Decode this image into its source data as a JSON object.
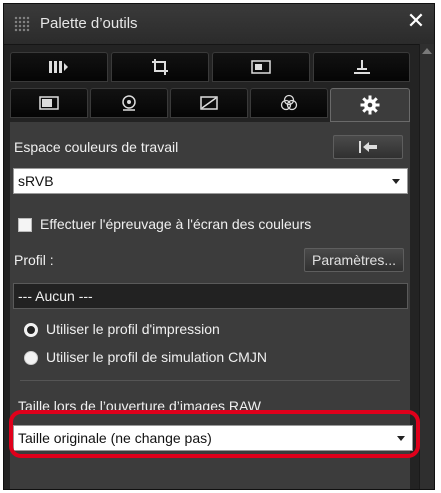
{
  "window": {
    "title": "Palette d’outils",
    "close_glyph": "✕"
  },
  "toolbar_row1": [
    {
      "icon": "page-bars-icon"
    },
    {
      "icon": "crop-icon"
    },
    {
      "icon": "image-icon"
    },
    {
      "icon": "stamp-icon"
    }
  ],
  "toolbar_row2": [
    {
      "icon": "image-box-icon"
    },
    {
      "icon": "loupe-icon"
    },
    {
      "icon": "tone-curve-icon"
    },
    {
      "icon": "color-wheel-icon"
    },
    {
      "icon": "gear-icon",
      "active": true
    }
  ],
  "working_color_space": {
    "label": "Espace couleurs de travail",
    "reset_button_icon": "reset-to-start-icon",
    "value": "sRVB"
  },
  "soft_proof": {
    "checkbox_label": "Effectuer l'épreuvage à l'écran des couleurs",
    "checked": false
  },
  "profile": {
    "label": "Profil :",
    "settings_button": "Paramètres...",
    "value": "--- Aucun ---",
    "options": [
      {
        "label": "Utiliser le profil d'impression",
        "selected": true
      },
      {
        "label": "Utiliser le profil de simulation CMJN",
        "selected": false
      }
    ]
  },
  "raw_open_size": {
    "label": "Taille lors de l’ouverture d’images RAW",
    "value": "Taille originale (ne change pas)"
  },
  "colors": {
    "highlight_border": "#e0001b",
    "panel_background": "#3c3c3c",
    "title_background": "#2b2b2b"
  }
}
